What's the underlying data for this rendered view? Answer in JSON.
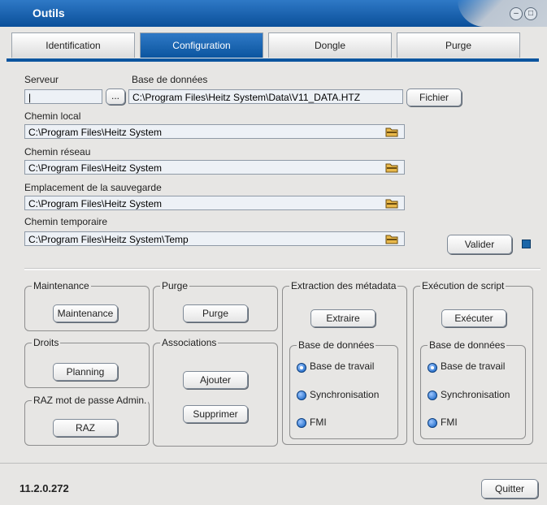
{
  "window": {
    "title": "Outils"
  },
  "tabs": [
    {
      "label": "Identification",
      "active": false
    },
    {
      "label": "Configuration",
      "active": true
    },
    {
      "label": "Dongle",
      "active": false
    },
    {
      "label": "Purge",
      "active": false
    }
  ],
  "config": {
    "serveur_label": "Serveur",
    "serveur_value": "|",
    "browse_label": "...",
    "db_label": "Base de données",
    "db_value": "C:\\Program Files\\Heitz System\\Data\\V11_DATA.HTZ",
    "fichier_label": "Fichier",
    "chemin_local_label": "Chemin local",
    "chemin_local_value": "C:\\Program Files\\Heitz System",
    "chemin_reseau_label": "Chemin réseau",
    "chemin_reseau_value": "C:\\Program Files\\Heitz System",
    "sauvegarde_label": "Emplacement de la sauvegarde",
    "sauvegarde_value": "C:\\Program Files\\Heitz System",
    "temp_label": "Chemin temporaire",
    "temp_value": "C:\\Program Files\\Heitz System\\Temp",
    "valider_label": "Valider"
  },
  "groups": {
    "maintenance": {
      "legend": "Maintenance",
      "button": "Maintenance"
    },
    "purge": {
      "legend": "Purge",
      "button": "Purge"
    },
    "extraction": {
      "legend": "Extraction des métadata",
      "button": "Extraire",
      "db_legend": "Base de données",
      "options": [
        "Base de travail",
        "Synchronisation",
        "FMI"
      ],
      "selected": 0
    },
    "script": {
      "legend": "Exécution de script",
      "button": "Exécuter",
      "db_legend": "Base de données",
      "options": [
        "Base de travail",
        "Synchronisation",
        "FMI"
      ],
      "selected": 0
    },
    "droits": {
      "legend": "Droits",
      "button": "Planning"
    },
    "associations": {
      "legend": "Associations",
      "add": "Ajouter",
      "remove": "Supprimer"
    },
    "raz": {
      "legend": "RAZ mot de passe Admin.",
      "button": "RAZ"
    }
  },
  "footer": {
    "version": "11.2.0.272",
    "quit_label": "Quitter"
  },
  "colors": {
    "accent": "#0b559f",
    "panel": "#e7e6e4"
  }
}
